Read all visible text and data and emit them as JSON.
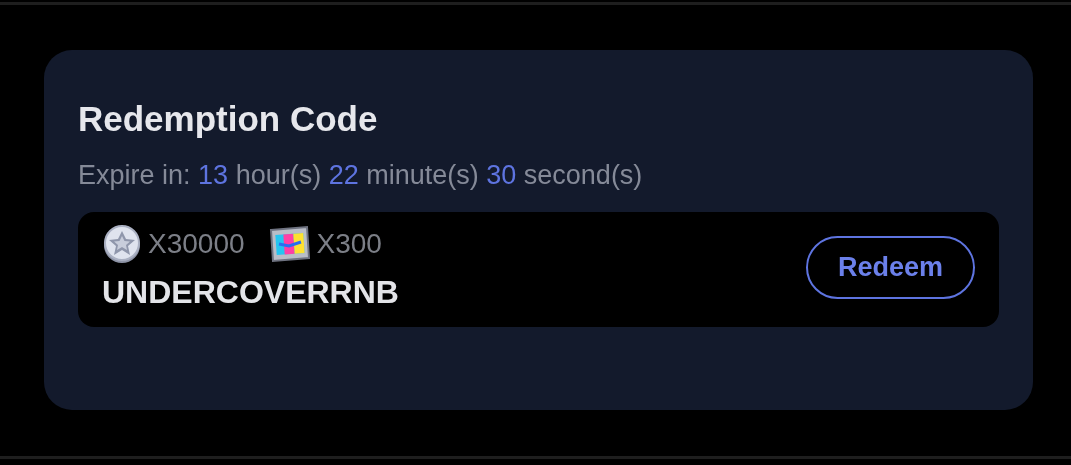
{
  "card": {
    "title": "Redemption Code",
    "expiry": {
      "label": "Expire in:",
      "parts": [
        {
          "value": "13",
          "unit": "hour(s)"
        },
        {
          "value": "22",
          "unit": "minute(s)"
        },
        {
          "value": "30",
          "unit": "second(s)"
        }
      ]
    },
    "code_entry": {
      "rewards": [
        {
          "kind": "coin",
          "amount": "X30000"
        },
        {
          "kind": "film",
          "amount": "X300"
        }
      ],
      "code": "UNDERCOVERRNB",
      "button": "Redeem"
    }
  }
}
